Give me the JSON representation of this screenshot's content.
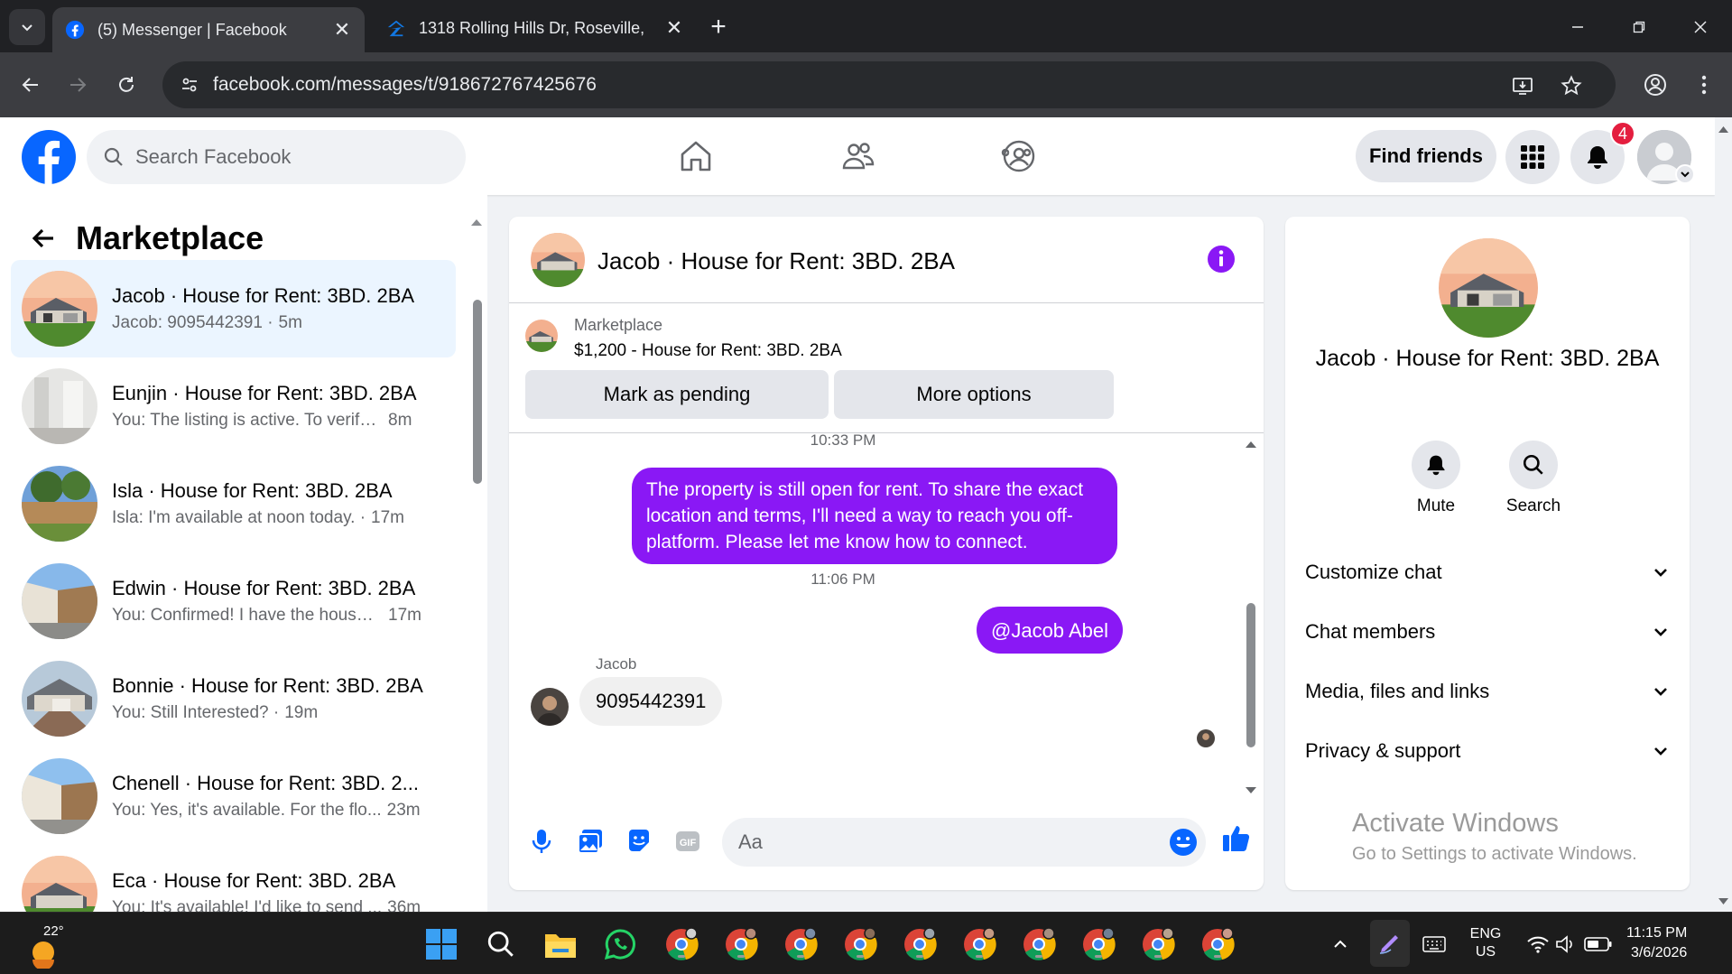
{
  "browser": {
    "tabs": [
      {
        "title": "(5) Messenger | Facebook",
        "active": true
      },
      {
        "title": "1318 Rolling Hills Dr, Roseville,",
        "active": false
      }
    ],
    "url": "facebook.com/messages/t/918672767425676"
  },
  "fb_header": {
    "search_placeholder": "Search Facebook",
    "find_friends_label": "Find friends",
    "notification_count": "4"
  },
  "left_panel": {
    "title": "Marketplace",
    "conversations": [
      {
        "name": "Jacob · House for Rent: 3BD. 2BA",
        "preview": "Jacob: 9095442391 ·",
        "time": "5m",
        "selected": true
      },
      {
        "name": "Eunjin · House for Rent: 3BD. 2BA",
        "preview": "You: The listing is active. To verify t...",
        "time": "8m"
      },
      {
        "name": "Isla · House for Rent: 3BD. 2BA",
        "preview": "Isla: I'm available at noon today. ·",
        "time": "17m"
      },
      {
        "name": "Edwin · House for Rent: 3BD. 2BA",
        "preview": "You: Confirmed! I have the house ...",
        "time": "17m"
      },
      {
        "name": "Bonnie · House for Rent: 3BD. 2BA",
        "preview": "You: Still Interested? ·",
        "time": "19m"
      },
      {
        "name": "Chenell · House for Rent: 3BD. 2...",
        "preview": "You: Yes, it's available. For the flo...",
        "time": "23m"
      },
      {
        "name": "Eca · House for Rent: 3BD. 2BA",
        "preview": "You: It's available! I'd like to send ...",
        "time": "36m"
      }
    ]
  },
  "chat": {
    "title": "Jacob · House for Rent: 3BD. 2BA",
    "listing_label": "Marketplace",
    "listing_price_title": "$1,200 - House for Rent: 3BD. 2BA",
    "mark_pending_label": "Mark as pending",
    "more_options_label": "More options",
    "messages": {
      "ts1": "10:33 PM",
      "out1": "The property is still open for rent. To share the exact location and terms, I'll need a way to reach you off-platform. Please let me know how to connect.",
      "ts2": "11:06 PM",
      "out2": "@Jacob Abel",
      "sender_name": "Jacob",
      "in1": "9095442391"
    },
    "composer_placeholder": "Aa"
  },
  "right_panel": {
    "name": "Jacob · House for Rent: 3BD. 2BA",
    "mute_label": "Mute",
    "search_label": "Search",
    "sections": [
      "Customize chat",
      "Chat members",
      "Media, files and links",
      "Privacy & support"
    ]
  },
  "watermark": {
    "line1": "Activate Windows",
    "line2": "Go to Settings to activate Windows."
  },
  "taskbar": {
    "temperature": "22°",
    "language_line1": "ENG",
    "language_line2": "US",
    "time": "11:15 PM",
    "date": "3/6/2026"
  },
  "colors": {
    "fb_blue": "#0866ff",
    "messenger_purple": "#8a18f5",
    "notification_red": "#e41e3f",
    "chrome_dark": "#202124"
  }
}
